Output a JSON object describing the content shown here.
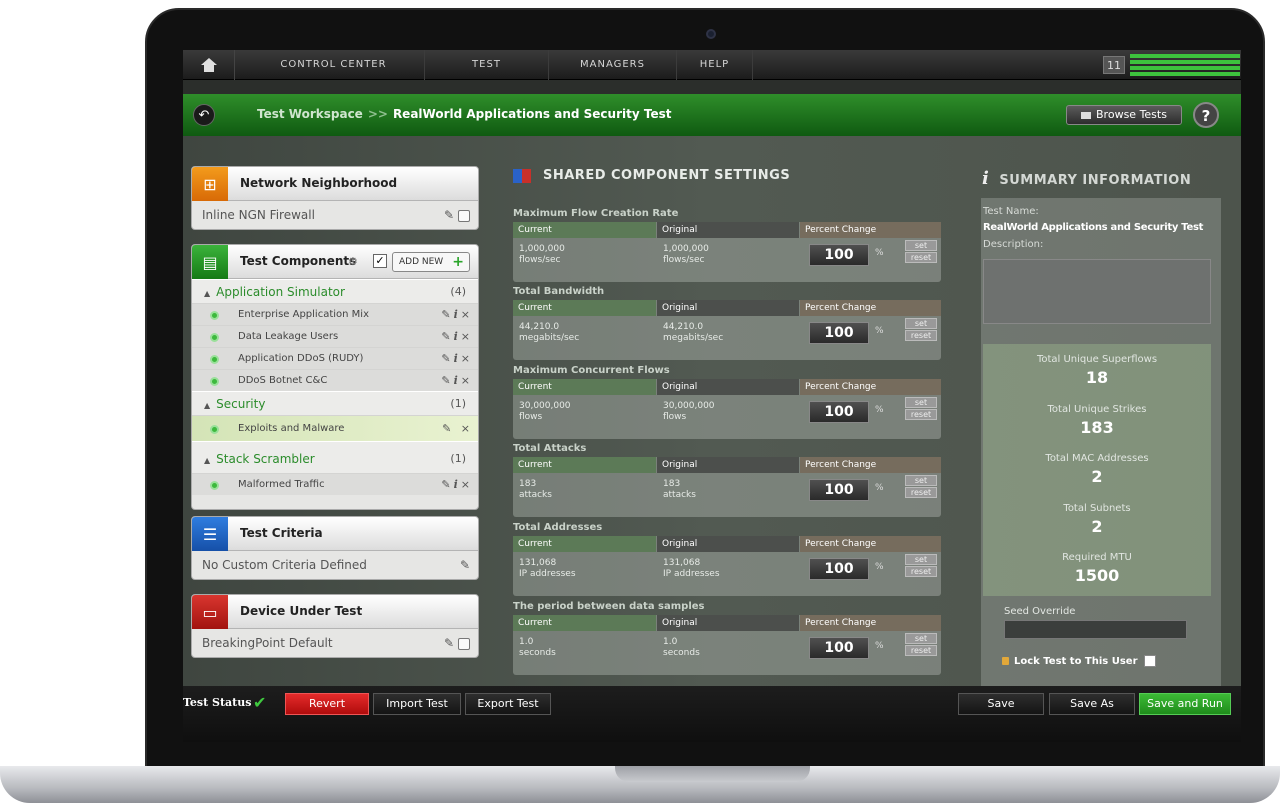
{
  "nav": {
    "items": [
      "CONTROL CENTER",
      "TEST",
      "MANAGERS",
      "HELP"
    ],
    "counter": "11"
  },
  "breadcrumb": {
    "root": "Test Workspace",
    "separator": ">>",
    "current": "RealWorld Applications and Security Test",
    "browse_label": "Browse Tests",
    "help_label": "?"
  },
  "network": {
    "title": "Network Neighborhood",
    "value": "Inline NGN Firewall"
  },
  "components": {
    "title": "Test Components",
    "add_new": "ADD NEW",
    "groups": [
      {
        "name": "Application Simulator",
        "count": "(4)",
        "items": [
          "Enterprise Application Mix",
          "Data Leakage Users",
          "Application DDoS (RUDY)",
          "DDoS Botnet C&C"
        ]
      },
      {
        "name": "Security",
        "count": "(1)",
        "items": [
          "Exploits and Malware"
        ]
      },
      {
        "name": "Stack Scrambler",
        "count": "(1)",
        "items": [
          "Malformed Traffic"
        ]
      }
    ]
  },
  "criteria": {
    "title": "Test Criteria",
    "value": "No Custom Criteria Defined"
  },
  "dut": {
    "title": "Device Under Test",
    "value": "BreakingPoint Default"
  },
  "shared": {
    "title": "SHARED COMPONENT SETTINGS",
    "col_current": "Current",
    "col_original": "Original",
    "col_percent": "Percent Change",
    "pct_sign": "%",
    "set_label": "set",
    "reset_label": "reset",
    "settings": [
      {
        "label": "Maximum Flow Creation Rate",
        "current": "1,000,000",
        "current_unit": "flows/sec",
        "original": "1,000,000",
        "original_unit": "flows/sec",
        "percent": "100"
      },
      {
        "label": "Total Bandwidth",
        "current": "44,210.0",
        "current_unit": "megabits/sec",
        "original": "44,210.0",
        "original_unit": "megabits/sec",
        "percent": "100"
      },
      {
        "label": "Maximum Concurrent Flows",
        "current": "30,000,000",
        "current_unit": "flows",
        "original": "30,000,000",
        "original_unit": "flows",
        "percent": "100"
      },
      {
        "label": "Total Attacks",
        "current": "183",
        "current_unit": "attacks",
        "original": "183",
        "original_unit": "attacks",
        "percent": "100"
      },
      {
        "label": "Total Addresses",
        "current": "131,068",
        "current_unit": "IP addresses",
        "original": "131,068",
        "original_unit": "IP addresses",
        "percent": "100"
      },
      {
        "label": "The period between data samples",
        "current": "1.0",
        "current_unit": "seconds",
        "original": "1.0",
        "original_unit": "seconds",
        "percent": "100"
      }
    ]
  },
  "summary": {
    "title": "SUMMARY INFORMATION",
    "test_name_label": "Test Name:",
    "test_name": "RealWorld Applications and Security Test",
    "description_label": "Description:",
    "stats": [
      {
        "label": "Total Unique Superflows",
        "value": "18"
      },
      {
        "label": "Total Unique Strikes",
        "value": "183"
      },
      {
        "label": "Total MAC Addresses",
        "value": "2"
      },
      {
        "label": "Total Subnets",
        "value": "2"
      },
      {
        "label": "Required MTU",
        "value": "1500"
      }
    ],
    "seed_label": "Seed Override",
    "lock_label": "Lock Test to This User"
  },
  "footer": {
    "status_label": "Test Status",
    "revert": "Revert",
    "import": "Import Test",
    "export": "Export Test",
    "save": "Save",
    "save_as": "Save As",
    "save_run": "Save and Run"
  },
  "colors": {
    "accent_green": "#2f8e2a",
    "revert_red": "#e52b2b",
    "run_green": "#3cba36",
    "status_green": "#3db93d"
  }
}
